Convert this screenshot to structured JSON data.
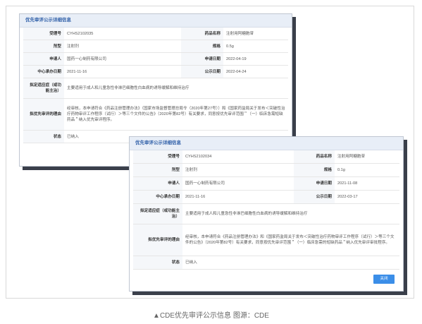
{
  "panel_title": "优先审评公示详细信息",
  "labels": {
    "accept_no": "受理号",
    "drug_name": "药品名称",
    "form": "剂型",
    "spec": "规格",
    "applicant": "申请人",
    "apply_date": "申请日期",
    "center_accept_date": "中心承办日期",
    "publicity_date": "公示日期",
    "indication": "拟定适应症（或功能主治）",
    "reason": "拟优先审评的理由",
    "status": "状态"
  },
  "record1": {
    "accept_no": "CYHS2102035",
    "drug_name": "注射用阿糖胞苷",
    "form": "注射剂",
    "spec": "0.5g",
    "applicant": "国药一心制药有限公司",
    "apply_date": "2022-04-19",
    "center_accept_date": "2021-11-16",
    "publicity_date": "2022-04-24",
    "indication": "主要适用于成人和儿童急性非淋巴细胞性白血病的诱导缓解和维持治疗",
    "reason": "经审核，本申请符合《药品注册管理办法》（国家市场监督管理总局令（2020年第27号））和《国家药监局关于发布＜突破性治疗药物审评工作程序（试行）＞等三个文件的公告》（2020年第82号）有关要求，同意按优先审评范围＂（一）临床急需短缺药品＂纳入优先审评程序。",
    "status": "已纳入"
  },
  "record2": {
    "accept_no": "CYHS2102034",
    "drug_name": "注射用阿糖胞苷",
    "form": "注射剂",
    "spec": "0.1g",
    "applicant": "国药一心制药有限公司",
    "apply_date": "2021-11-08",
    "center_accept_date": "2021-11-16",
    "publicity_date": "2022-03-17",
    "indication": "主要适用于成人和儿童急性非淋巴细胞性白血病的诱导缓解和维持治疗",
    "reason": "经审核，本申请符合《药品注册管理办法》和《国家药监局关于发布＜突破性治疗药物审评工作程序（试行）＞等三个文件的公告》（2020年第82号）有关要求，同意按优先审评范围＂（一）临床急需的短缺药品＂纳入优先审评审批程序。",
    "status": "已纳入"
  },
  "close_button": "关闭",
  "caption": "▲CDE优先审评公示信息 图源：CDE"
}
